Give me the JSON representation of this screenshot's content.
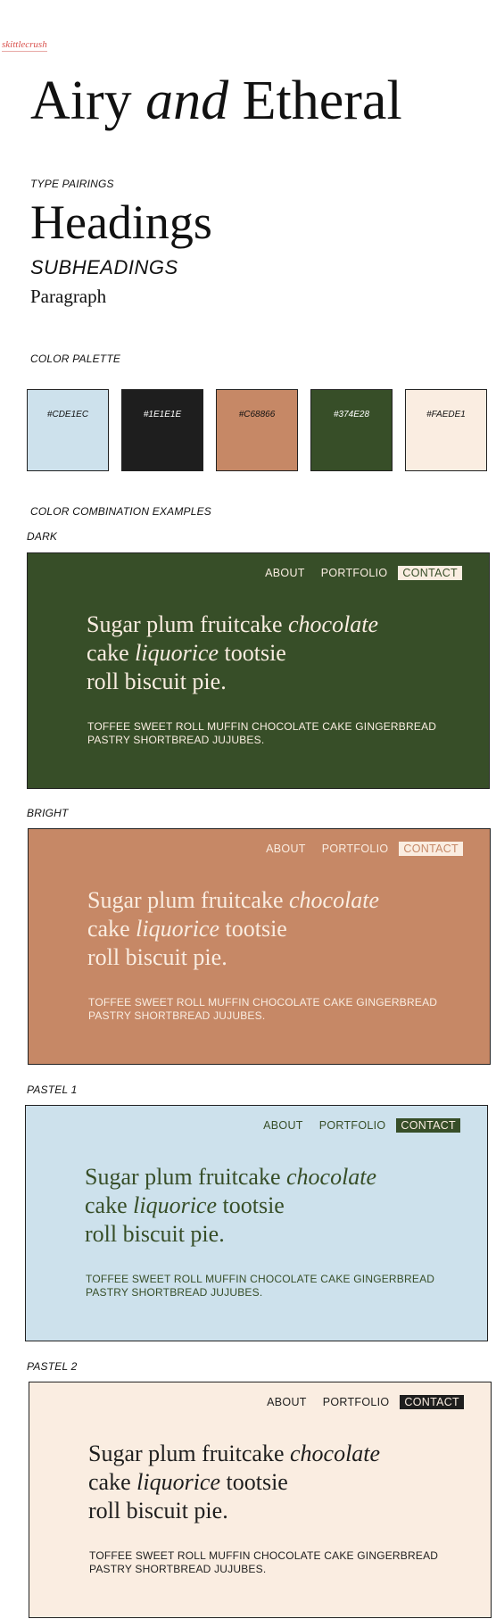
{
  "logo": "skittlecrush",
  "title": {
    "part1": "Airy ",
    "part2": "and",
    "part3": " Etheral"
  },
  "sections": {
    "type_pairings": "TYPE PAIRINGS",
    "color_palette": "COLOR PALETTE",
    "combos": "COLOR COMBINATION EXAMPLES"
  },
  "type_samples": {
    "heading": "Headings",
    "subheading": "SUBHEADINGS",
    "paragraph": "Paragraph"
  },
  "palette": [
    {
      "hex": "#CDE1EC",
      "color": "#cde1ec",
      "text_color": "#111111"
    },
    {
      "hex": "#1E1E1E",
      "color": "#1e1e1e",
      "text_color": "#ffffff"
    },
    {
      "hex": "#C68866",
      "color": "#c68866",
      "text_color": "#111111"
    },
    {
      "hex": "#374E28",
      "color": "#374e28",
      "text_color": "#ffffff"
    },
    {
      "hex": "#FAEDE1",
      "color": "#faede1",
      "text_color": "#111111"
    }
  ],
  "nav": {
    "about": "ABOUT",
    "portfolio": "PORTFOLIO",
    "contact": "CONTACT"
  },
  "hero": {
    "l1a": "Sugar plum fruitcake ",
    "l1b": "chocolate",
    "l2a": "cake ",
    "l2b": "liquorice",
    "l2c": " tootsie",
    "l3": "roll biscuit pie."
  },
  "body": "TOFFEE SWEET ROLL MUFFIN CHOCOLATE CAKE GINGERBREAD PASTRY SHORTBREAD JUJUBES.",
  "examples": [
    {
      "label": "DARK",
      "bg": "#374e28",
      "fg": "#faede1",
      "btn_bg": "#faede1",
      "btn_fg": "#374e28"
    },
    {
      "label": "BRIGHT",
      "bg": "#c68866",
      "fg": "#faede1",
      "btn_bg": "#faede1",
      "btn_fg": "#c68866"
    },
    {
      "label": "PASTEL 1",
      "bg": "#cde1ec",
      "fg": "#374e28",
      "btn_bg": "#374e28",
      "btn_fg": "#faede1"
    },
    {
      "label": "PASTEL 2",
      "bg": "#faede1",
      "fg": "#1e1e1e",
      "btn_bg": "#1e1e1e",
      "btn_fg": "#faede1"
    }
  ]
}
